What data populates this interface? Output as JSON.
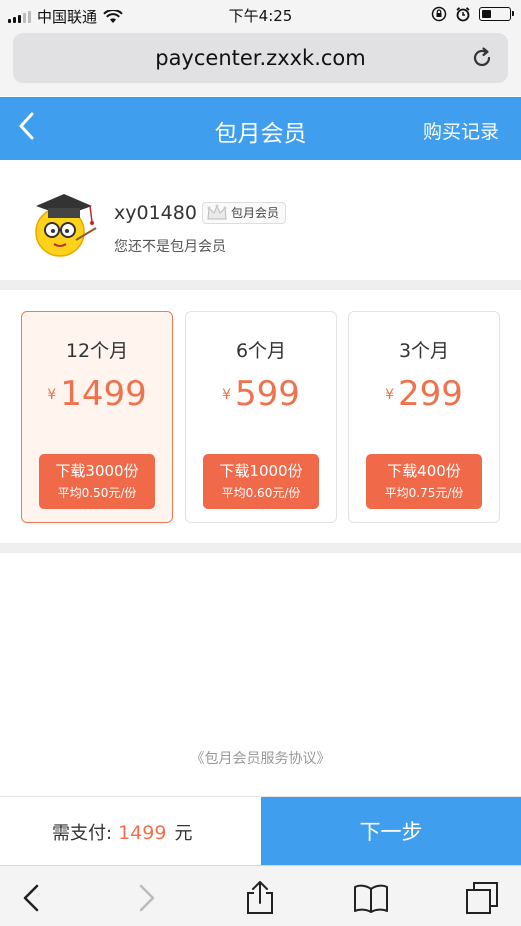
{
  "status_bar": {
    "carrier": "中国联通",
    "time": "下午4:25"
  },
  "browser": {
    "url": "paycenter.zxxk.com"
  },
  "header": {
    "title": "包月会员",
    "right_link": "购买记录"
  },
  "user": {
    "username": "xy01480",
    "badge": "包月会员",
    "status": "您还不是包月会员"
  },
  "plans": [
    {
      "period": "12个月",
      "currency": "¥",
      "price": "1499",
      "downloads": "下载3000份",
      "average": "平均0.50元/份",
      "selected": true
    },
    {
      "period": "6个月",
      "currency": "¥",
      "price": "599",
      "downloads": "下载1000份",
      "average": "平均0.60元/份",
      "selected": false
    },
    {
      "period": "3个月",
      "currency": "¥",
      "price": "299",
      "downloads": "下载400份",
      "average": "平均0.75元/份",
      "selected": false
    }
  ],
  "agreement": "《包月会员服务协议》",
  "footer": {
    "pay_label": "需支付:",
    "pay_amount": "1499",
    "pay_unit": "元",
    "next_button": "下一步"
  },
  "colors": {
    "primary": "#3f9eee",
    "accent": "#f06a4a",
    "selected_bg": "#fff4ee"
  },
  "icons": [
    "signal-icon",
    "wifi-icon",
    "lock-rotation-icon",
    "alarm-icon",
    "battery-icon",
    "reload-icon",
    "back-chevron-icon",
    "avatar-scholar-icon",
    "crown-icon",
    "share-icon",
    "bookmarks-icon",
    "tabs-icon"
  ]
}
